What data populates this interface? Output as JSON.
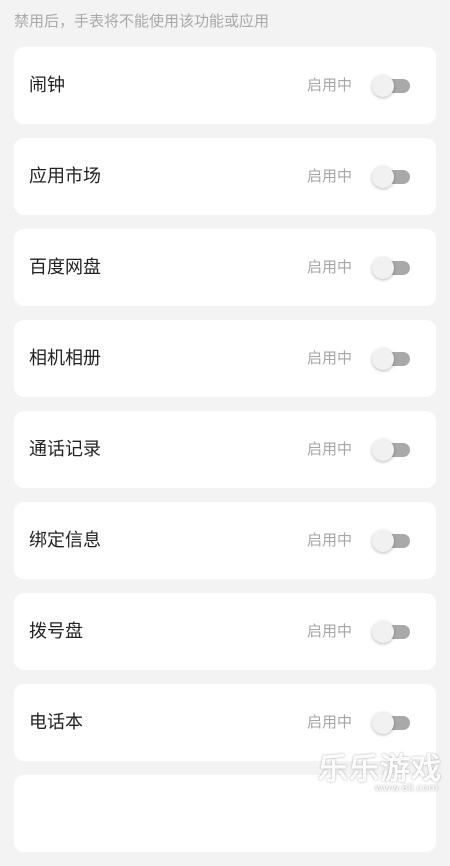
{
  "header": {
    "hint": "禁用后，手表将不能使用该功能或应用"
  },
  "items": [
    {
      "name": "闹钟",
      "status": "启用中",
      "enabled": false
    },
    {
      "name": "应用市场",
      "status": "启用中",
      "enabled": false
    },
    {
      "name": "百度网盘",
      "status": "启用中",
      "enabled": false
    },
    {
      "name": "相机相册",
      "status": "启用中",
      "enabled": false
    },
    {
      "name": "通话记录",
      "status": "启用中",
      "enabled": false
    },
    {
      "name": "绑定信息",
      "status": "启用中",
      "enabled": false
    },
    {
      "name": "拨号盘",
      "status": "启用中",
      "enabled": false
    },
    {
      "name": "电话本",
      "status": "启用中",
      "enabled": false
    },
    {
      "name": "",
      "status": "",
      "enabled": false
    }
  ],
  "watermark": {
    "brand": "乐乐游戏",
    "url": "www.6ll.com"
  },
  "colors": {
    "background": "#f3f3f3",
    "card": "#ffffff",
    "toggle_track": "#a9a9a9",
    "toggle_knob": "#f1f1f1"
  }
}
